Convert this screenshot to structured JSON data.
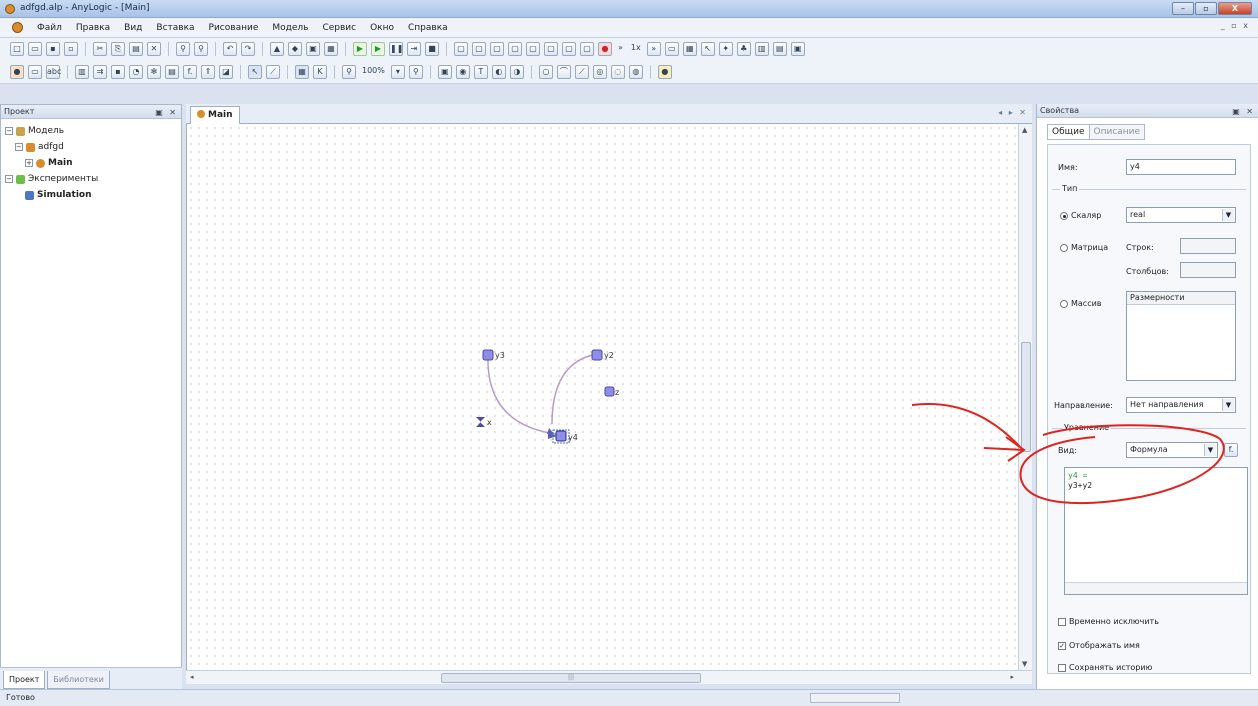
{
  "window": {
    "title": "adfgd.alp - AnyLogic - [Main]",
    "buttons": [
      "–",
      "▫",
      "X"
    ]
  },
  "menu": [
    "Файл",
    "Правка",
    "Вид",
    "Вставка",
    "Рисование",
    "Модель",
    "Сервис",
    "Окно",
    "Справка"
  ],
  "toolbar": {
    "speed": "1x",
    "zoom": "100%"
  },
  "project_panel": {
    "title": "Проект",
    "tree": [
      {
        "label": "Модель",
        "level": 0
      },
      {
        "label": "adfgd",
        "level": 1
      },
      {
        "label": "Main",
        "level": 2
      },
      {
        "label": "Эксперименты",
        "level": 0
      },
      {
        "label": "Simulation",
        "level": 1
      }
    ],
    "tabs": [
      "Проект",
      "Библиотеки"
    ]
  },
  "editor": {
    "tab": "Main",
    "elements": {
      "y3": "y3",
      "y2": "y2",
      "z": "z",
      "x": "x",
      "y4": "y4"
    }
  },
  "properties": {
    "title": "Свойства",
    "tabs": [
      "Общие",
      "Описание"
    ],
    "name_label": "Имя:",
    "name_value": "y4",
    "type_group": "Тип",
    "scalar": "Скаляр",
    "scalar_type": "real",
    "matrix": "Матрица",
    "rows_label": "Строк:",
    "cols_label": "Столбцов:",
    "array": "Массив",
    "dims_header": "Размерности",
    "direction_label": "Направление:",
    "direction_value": "Нет направления",
    "equation_group": "Уравнение",
    "view_label": "Вид:",
    "view_value": "Формула",
    "formula_line1": "y4 =",
    "formula_line2": "y3+y2",
    "chk_exclude": "Временно исключить",
    "chk_show_name": "Отображать имя",
    "chk_history": "Сохранять историю"
  },
  "status": "Готово",
  "annotation_color": "#e0231e"
}
